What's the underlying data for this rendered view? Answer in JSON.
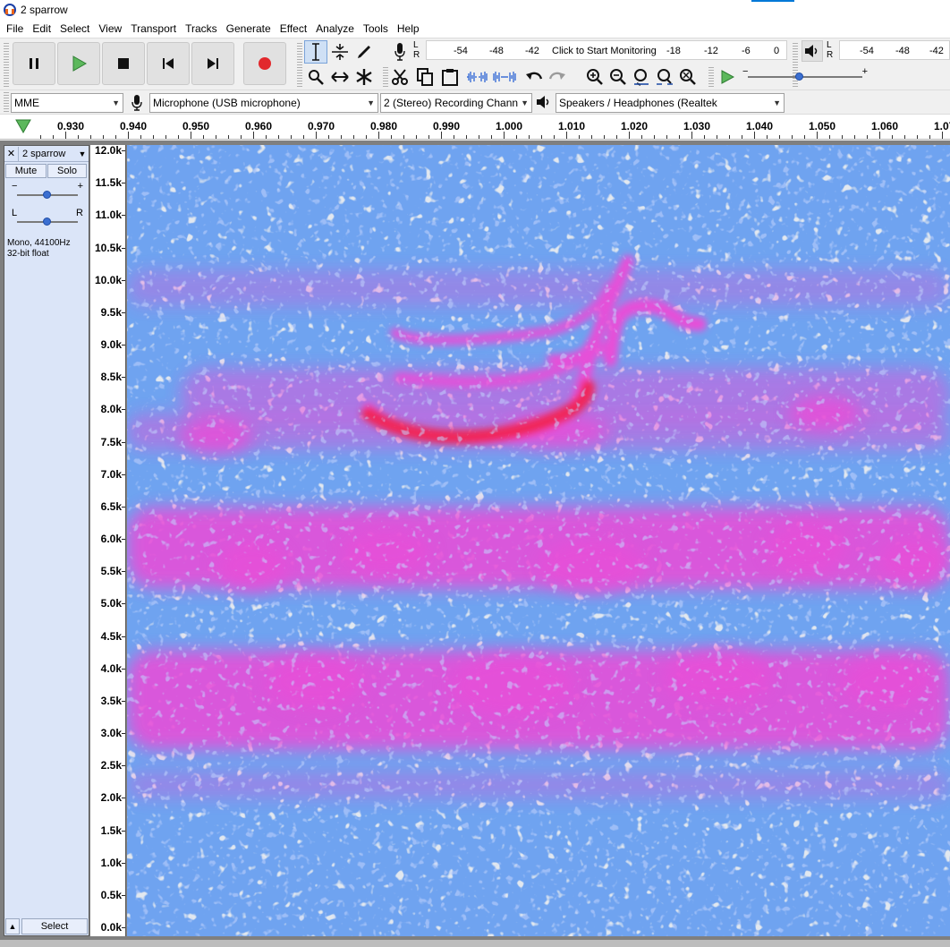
{
  "window": {
    "title": "2 sparrow"
  },
  "menu": [
    "File",
    "Edit",
    "Select",
    "View",
    "Transport",
    "Tracks",
    "Generate",
    "Effect",
    "Analyze",
    "Tools",
    "Help"
  ],
  "transport": {
    "buttons": [
      "pause",
      "play",
      "stop",
      "skip-to-start",
      "skip-to-end",
      "record"
    ]
  },
  "meters": {
    "record": {
      "lr_left": "L",
      "lr_right": "R",
      "ticks": [
        "-54",
        "-48",
        "-42",
        "-18",
        "-12",
        "-6",
        "0"
      ],
      "prompt": "Click to Start Monitoring"
    },
    "playback": {
      "lr_left": "L",
      "lr_right": "R",
      "ticks": [
        "-54",
        "-48",
        "-42"
      ]
    },
    "play_speed": {
      "minus": "−",
      "plus": "+",
      "level": 0.45
    }
  },
  "devices": {
    "host": "MME",
    "recording_device": "Microphone (USB microphone)",
    "channels": "2 (Stereo) Recording Chann",
    "playback_device": "Speakers / Headphones (Realtek"
  },
  "timeline": {
    "labels": [
      "0.930",
      "0.940",
      "0.950",
      "0.960",
      "0.970",
      "0.980",
      "0.990",
      "1.000",
      "1.010",
      "1.020",
      "1.030",
      "1.040",
      "1.050",
      "1.060",
      "1.07"
    ]
  },
  "track": {
    "name": "2 sparrow",
    "close": "✕",
    "menu_arrow": "▼",
    "mute": "Mute",
    "solo": "Solo",
    "gain_minus": "−",
    "gain_plus": "+",
    "gain_level": 0.5,
    "pan_left": "L",
    "pan_right": "R",
    "pan_level": 0.5,
    "info_line1": "Mono, 44100Hz",
    "info_line2": "32-bit float",
    "collapse": "▲",
    "select": "Select"
  },
  "frequency_axis": {
    "labels": [
      "12.0k",
      "11.5k",
      "11.0k",
      "10.5k",
      "10.0k",
      "9.5k",
      "9.0k",
      "8.5k",
      "8.0k",
      "7.5k",
      "7.0k",
      "6.5k",
      "6.0k",
      "5.5k",
      "5.0k",
      "4.5k",
      "4.0k",
      "3.5k",
      "3.0k",
      "2.5k",
      "2.0k",
      "1.5k",
      "1.0k",
      "0.5k",
      "0.0k"
    ]
  },
  "colors": {
    "spectrogram_bg": "#6fa3f0",
    "spectrogram_band": "#e64fd8",
    "spectrogram_hot": "#f0285a",
    "spectrogram_speckle": "#e8e6dc"
  }
}
